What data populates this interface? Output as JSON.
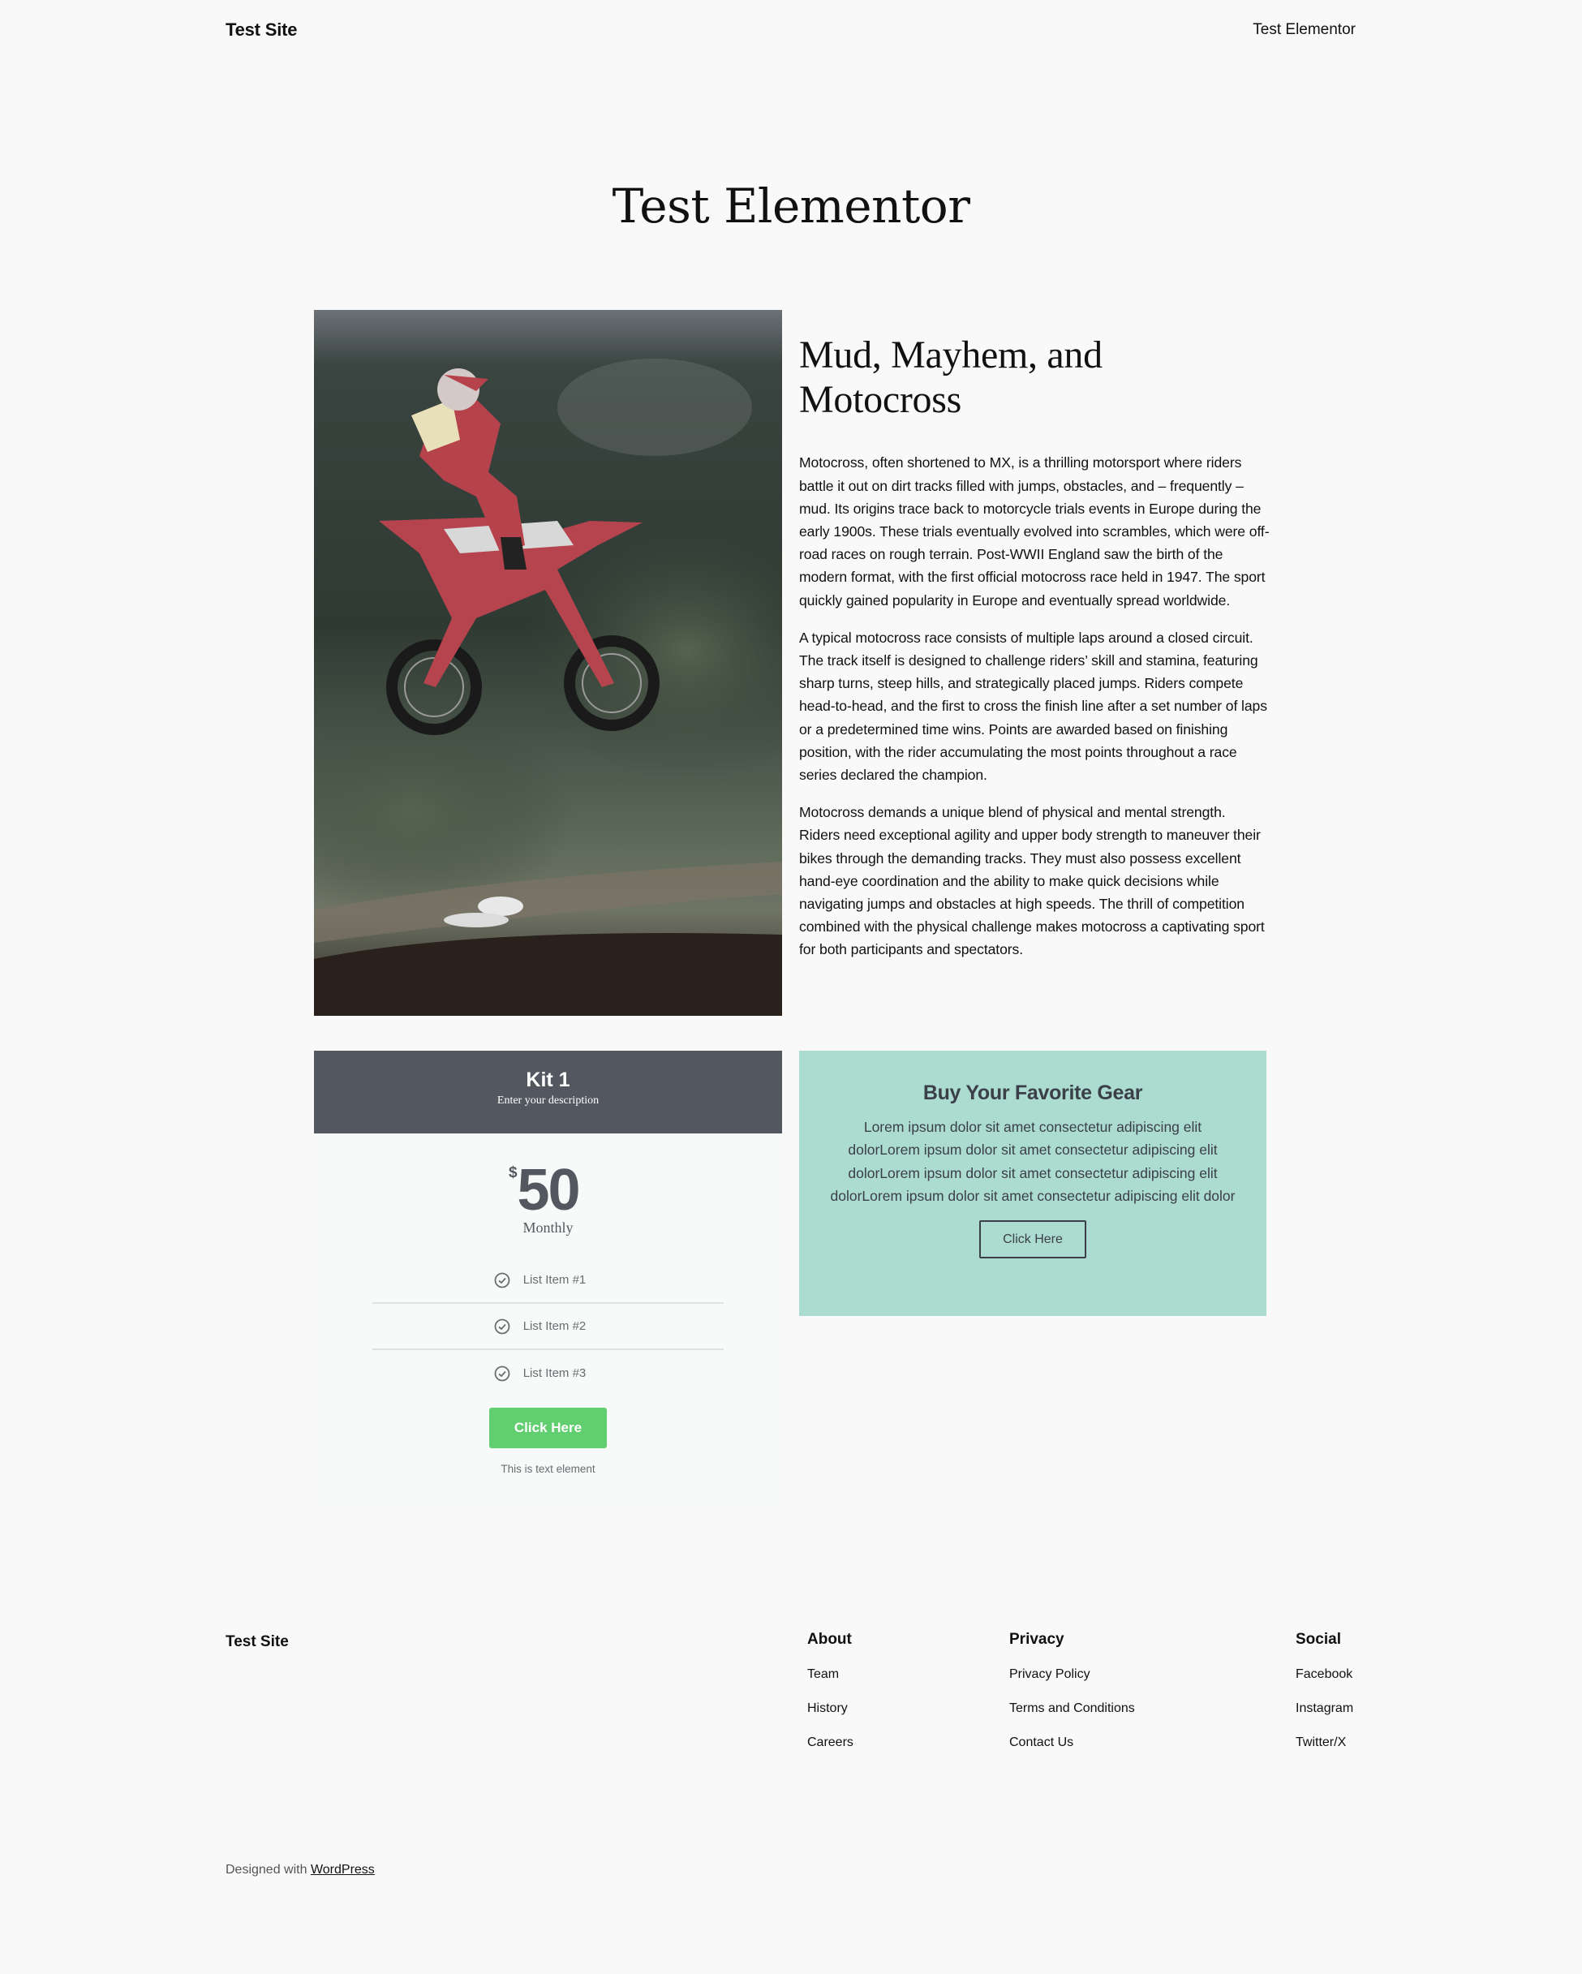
{
  "header": {
    "site_title": "Test Site",
    "nav_link": "Test Elementor"
  },
  "page": {
    "title": "Test Elementor"
  },
  "hero_image": {
    "alt": "motocross rider jumping dirt bike"
  },
  "article": {
    "heading": "Mud, Mayhem, and Motocross",
    "paragraphs": [
      "Motocross, often shortened to MX, is a thrilling motorsport where riders battle it out on dirt tracks filled with jumps, obstacles, and – frequently – mud. Its origins trace back to motorcycle trials events in Europe during the early 1900s. These trials eventually evolved into scrambles, which were off-road races on rough terrain. Post-WWII England saw the birth of the modern format, with the first official motocross race held in 1947. The sport quickly gained popularity in Europe and eventually spread worldwide.",
      "A typical motocross race consists of multiple laps around a closed circuit. The track itself is designed to challenge riders’ skill and stamina, featuring sharp turns, steep hills, and strategically placed jumps. Riders compete head-to-head, and the first to cross the finish line after a set number of laps or a predetermined time wins. Points are awarded based on finishing position, with the rider accumulating the most points throughout a race series declared the champion.",
      "Motocross demands a unique blend of physical and mental strength. Riders need exceptional agility and upper body strength to maneuver their bikes through the demanding tracks. They must also possess excellent hand-eye coordination and the ability to make quick decisions while navigating jumps and obstacles at high speeds. The thrill of competition combined with the physical challenge makes motocross a captivating sport for both participants and spectators."
    ]
  },
  "pricing": {
    "title": "Kit 1",
    "description": "Enter your description",
    "currency": "$",
    "price": "50",
    "period": "Monthly",
    "features": [
      {
        "icon": "check-circle-icon",
        "label": "List Item #1"
      },
      {
        "icon": "check-circle-icon",
        "label": "List Item #2"
      },
      {
        "icon": "check-circle-icon",
        "label": "List Item #3"
      }
    ],
    "button_label": "Click Here",
    "footnote": "This is text element",
    "colors": {
      "header_bg": "#53575f",
      "button_bg": "#61ce70"
    }
  },
  "cta": {
    "heading": "Buy Your Favorite Gear",
    "body": "Lorem ipsum dolor sit amet consectetur adipiscing elit dolorLorem ipsum dolor sit amet consectetur adipiscing elit dolorLorem ipsum dolor sit amet consectetur adipiscing elit dolorLorem ipsum dolor sit amet consectetur adipiscing elit dolor",
    "button_label": "Click Here",
    "colors": {
      "bg": "#acdbcf"
    }
  },
  "footer": {
    "site_title": "Test Site",
    "columns": [
      {
        "heading": "About",
        "links": [
          "Team",
          "History",
          "Careers"
        ]
      },
      {
        "heading": "Privacy",
        "links": [
          "Privacy Policy",
          "Terms and Conditions",
          "Contact Us"
        ]
      },
      {
        "heading": "Social",
        "links": [
          "Facebook",
          "Instagram",
          "Twitter/X"
        ]
      }
    ],
    "credits_prefix": "Designed with ",
    "credits_link": "WordPress"
  }
}
